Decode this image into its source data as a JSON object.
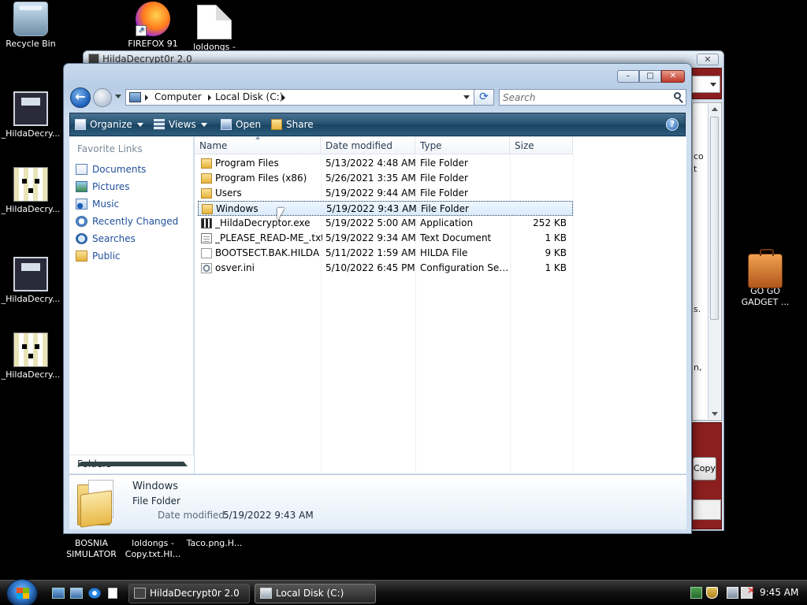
{
  "desktop": {
    "icons": [
      {
        "label": "Recycle Bin"
      },
      {
        "label": "FIREFOX 91"
      },
      {
        "label": "loldongs -"
      },
      {
        "label": "_HildaDecry..."
      },
      {
        "label": "_HildaDecry..."
      },
      {
        "label": "_HildaDecry..."
      },
      {
        "label": "_HildaDecry..."
      },
      {
        "label": "GO GO GADGET ..."
      },
      {
        "label": "BOSNIA SIMULATOR"
      },
      {
        "label": "loldongs - Copy.txt.HI..."
      },
      {
        "label": "Taco.png.H..."
      }
    ]
  },
  "bg_window": {
    "title": "HildaDecrypt0r 2.0",
    "close_label": "✕",
    "text_fragments": [
      "co",
      "t",
      "s.",
      "n,"
    ],
    "copy_label": "Copy"
  },
  "explorer": {
    "controls": {
      "minimize": "–",
      "maximize": "□",
      "close": "✕"
    },
    "back_glyph": "←",
    "address": {
      "crumbs": [
        "Computer",
        "Local Disk (C:)"
      ]
    },
    "refresh_glyph": "⟳",
    "search": {
      "placeholder": "Search"
    },
    "commands": [
      {
        "label": "Organize",
        "icon": "organize-icon"
      },
      {
        "label": "Views",
        "icon": "views-icon"
      },
      {
        "label": "Open",
        "icon": "open-icon"
      },
      {
        "label": "Share",
        "icon": "share-icon"
      }
    ],
    "help_glyph": "?",
    "favorite_links": {
      "header": "Favorite Links",
      "items": [
        "Documents",
        "Pictures",
        "Music",
        "Recently Changed",
        "Searches",
        "Public"
      ]
    },
    "folders_label": "Folders",
    "columns": [
      "Name",
      "Date modified",
      "Type",
      "Size"
    ],
    "files": [
      {
        "name": "Program Files",
        "date": "5/13/2022 4:48 AM",
        "type": "File Folder",
        "size": "",
        "icon": "folder-icon"
      },
      {
        "name": "Program Files (x86)",
        "date": "5/26/2021 3:35 AM",
        "type": "File Folder",
        "size": "",
        "icon": "folder-icon"
      },
      {
        "name": "Users",
        "date": "5/19/2022 9:44 AM",
        "type": "File Folder",
        "size": "",
        "icon": "folder-icon"
      },
      {
        "name": "Windows",
        "date": "5/19/2022 9:43 AM",
        "type": "File Folder",
        "size": "",
        "icon": "folder-icon",
        "selected": true
      },
      {
        "name": "_HildaDecryptor.exe",
        "date": "5/19/2022 5:00 AM",
        "type": "Application",
        "size": "252 KB",
        "icon": "application-icon"
      },
      {
        "name": "_PLEASE_READ-ME_.txt",
        "date": "5/19/2022 9:34 AM",
        "type": "Text Document",
        "size": "1 KB",
        "icon": "text-file-icon"
      },
      {
        "name": "BOOTSECT.BAK.HILDA",
        "date": "5/11/2022 1:59 AM",
        "type": "HILDA File",
        "size": "9 KB",
        "icon": "file-icon"
      },
      {
        "name": "osver.ini",
        "date": "5/10/2022 6:45 PM",
        "type": "Configuration Sett...",
        "size": "1 KB",
        "icon": "settings-file-icon"
      }
    ],
    "details": {
      "name": "Windows",
      "type": "File Folder",
      "modified_label": "Date modified:",
      "modified_value": "5/19/2022 9:43 AM"
    }
  },
  "taskbar": {
    "buttons": [
      {
        "label": "HildaDecrypt0r 2.0"
      },
      {
        "label": "Local Disk (C:)"
      }
    ],
    "clock": "9:45 AM"
  }
}
